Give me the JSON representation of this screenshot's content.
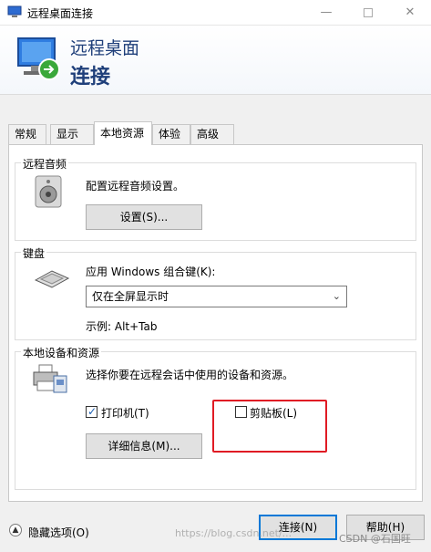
{
  "window": {
    "title": "远程桌面连接",
    "minimize_glyph": "—",
    "close_glyph": "✕"
  },
  "header": {
    "line1": "远程桌面",
    "line2": "连接"
  },
  "tabs": [
    {
      "label": "常规"
    },
    {
      "label": "显示"
    },
    {
      "label": "本地资源",
      "active": true
    },
    {
      "label": "体验"
    },
    {
      "label": "高级"
    }
  ],
  "audio": {
    "group_label": "远程音频",
    "description": "配置远程音频设置。",
    "settings_button": "设置(S)..."
  },
  "keyboard": {
    "group_label": "键盘",
    "description": "应用 Windows 组合键(K):",
    "selected_option": "仅在全屏显示时",
    "example": "示例: Alt+Tab"
  },
  "local_devices": {
    "group_label": "本地设备和资源",
    "description": "选择你要在远程会话中使用的设备和资源。",
    "printer_label": "打印机(T)",
    "printer_checked": true,
    "clipboard_label": "剪贴板(L)",
    "clipboard_checked": false,
    "details_button": "详细信息(M)..."
  },
  "footer": {
    "hide_options": "隐藏选项(O)",
    "connect_button": "连接(N)",
    "help_button": "帮助(H)",
    "watermark_url": "https://blog.csdn.net/...",
    "watermark_author": "CSDN @石国旺"
  }
}
